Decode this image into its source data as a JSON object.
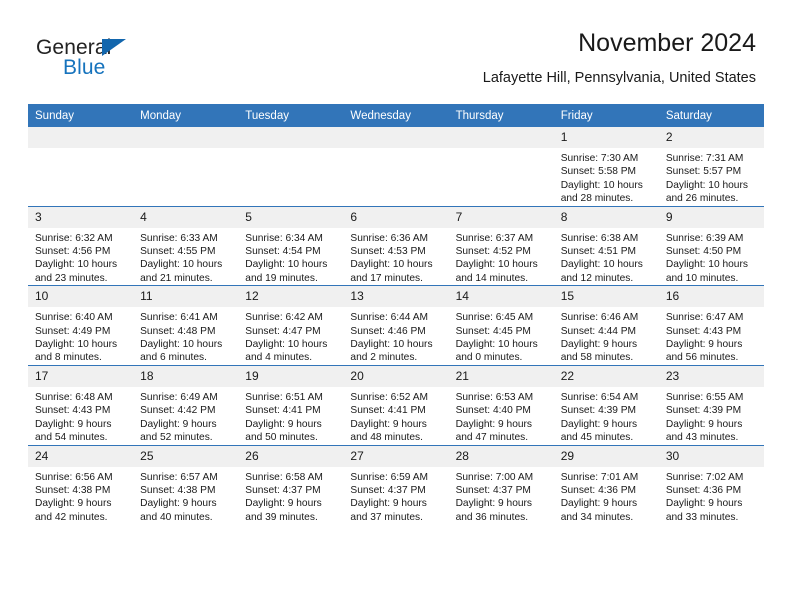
{
  "brand": {
    "name_part1": "General",
    "name_part2": "Blue",
    "flag_color": "#1266ad",
    "blue_text_color": "#1673bd"
  },
  "header": {
    "title": "November 2024",
    "subtitle": "Lafayette Hill, Pennsylvania, United States",
    "accent_color": "#3275b9",
    "daynum_band_color": "#f0f0f0"
  },
  "weekday_headers": [
    "Sunday",
    "Monday",
    "Tuesday",
    "Wednesday",
    "Thursday",
    "Friday",
    "Saturday"
  ],
  "weeks": [
    [
      {
        "day": "",
        "sunrise": "",
        "sunset": "",
        "daylight_line1": "",
        "daylight_line2": "",
        "empty": true
      },
      {
        "day": "",
        "sunrise": "",
        "sunset": "",
        "daylight_line1": "",
        "daylight_line2": "",
        "empty": true
      },
      {
        "day": "",
        "sunrise": "",
        "sunset": "",
        "daylight_line1": "",
        "daylight_line2": "",
        "empty": true
      },
      {
        "day": "",
        "sunrise": "",
        "sunset": "",
        "daylight_line1": "",
        "daylight_line2": "",
        "empty": true
      },
      {
        "day": "",
        "sunrise": "",
        "sunset": "",
        "daylight_line1": "",
        "daylight_line2": "",
        "empty": true
      },
      {
        "day": "1",
        "sunrise": "Sunrise: 7:30 AM",
        "sunset": "Sunset: 5:58 PM",
        "daylight_line1": "Daylight: 10 hours",
        "daylight_line2": "and 28 minutes.",
        "empty": false
      },
      {
        "day": "2",
        "sunrise": "Sunrise: 7:31 AM",
        "sunset": "Sunset: 5:57 PM",
        "daylight_line1": "Daylight: 10 hours",
        "daylight_line2": "and 26 minutes.",
        "empty": false
      }
    ],
    [
      {
        "day": "3",
        "sunrise": "Sunrise: 6:32 AM",
        "sunset": "Sunset: 4:56 PM",
        "daylight_line1": "Daylight: 10 hours",
        "daylight_line2": "and 23 minutes.",
        "empty": false
      },
      {
        "day": "4",
        "sunrise": "Sunrise: 6:33 AM",
        "sunset": "Sunset: 4:55 PM",
        "daylight_line1": "Daylight: 10 hours",
        "daylight_line2": "and 21 minutes.",
        "empty": false
      },
      {
        "day": "5",
        "sunrise": "Sunrise: 6:34 AM",
        "sunset": "Sunset: 4:54 PM",
        "daylight_line1": "Daylight: 10 hours",
        "daylight_line2": "and 19 minutes.",
        "empty": false
      },
      {
        "day": "6",
        "sunrise": "Sunrise: 6:36 AM",
        "sunset": "Sunset: 4:53 PM",
        "daylight_line1": "Daylight: 10 hours",
        "daylight_line2": "and 17 minutes.",
        "empty": false
      },
      {
        "day": "7",
        "sunrise": "Sunrise: 6:37 AM",
        "sunset": "Sunset: 4:52 PM",
        "daylight_line1": "Daylight: 10 hours",
        "daylight_line2": "and 14 minutes.",
        "empty": false
      },
      {
        "day": "8",
        "sunrise": "Sunrise: 6:38 AM",
        "sunset": "Sunset: 4:51 PM",
        "daylight_line1": "Daylight: 10 hours",
        "daylight_line2": "and 12 minutes.",
        "empty": false
      },
      {
        "day": "9",
        "sunrise": "Sunrise: 6:39 AM",
        "sunset": "Sunset: 4:50 PM",
        "daylight_line1": "Daylight: 10 hours",
        "daylight_line2": "and 10 minutes.",
        "empty": false
      }
    ],
    [
      {
        "day": "10",
        "sunrise": "Sunrise: 6:40 AM",
        "sunset": "Sunset: 4:49 PM",
        "daylight_line1": "Daylight: 10 hours",
        "daylight_line2": "and 8 minutes.",
        "empty": false
      },
      {
        "day": "11",
        "sunrise": "Sunrise: 6:41 AM",
        "sunset": "Sunset: 4:48 PM",
        "daylight_line1": "Daylight: 10 hours",
        "daylight_line2": "and 6 minutes.",
        "empty": false
      },
      {
        "day": "12",
        "sunrise": "Sunrise: 6:42 AM",
        "sunset": "Sunset: 4:47 PM",
        "daylight_line1": "Daylight: 10 hours",
        "daylight_line2": "and 4 minutes.",
        "empty": false
      },
      {
        "day": "13",
        "sunrise": "Sunrise: 6:44 AM",
        "sunset": "Sunset: 4:46 PM",
        "daylight_line1": "Daylight: 10 hours",
        "daylight_line2": "and 2 minutes.",
        "empty": false
      },
      {
        "day": "14",
        "sunrise": "Sunrise: 6:45 AM",
        "sunset": "Sunset: 4:45 PM",
        "daylight_line1": "Daylight: 10 hours",
        "daylight_line2": "and 0 minutes.",
        "empty": false
      },
      {
        "day": "15",
        "sunrise": "Sunrise: 6:46 AM",
        "sunset": "Sunset: 4:44 PM",
        "daylight_line1": "Daylight: 9 hours",
        "daylight_line2": "and 58 minutes.",
        "empty": false
      },
      {
        "day": "16",
        "sunrise": "Sunrise: 6:47 AM",
        "sunset": "Sunset: 4:43 PM",
        "daylight_line1": "Daylight: 9 hours",
        "daylight_line2": "and 56 minutes.",
        "empty": false
      }
    ],
    [
      {
        "day": "17",
        "sunrise": "Sunrise: 6:48 AM",
        "sunset": "Sunset: 4:43 PM",
        "daylight_line1": "Daylight: 9 hours",
        "daylight_line2": "and 54 minutes.",
        "empty": false
      },
      {
        "day": "18",
        "sunrise": "Sunrise: 6:49 AM",
        "sunset": "Sunset: 4:42 PM",
        "daylight_line1": "Daylight: 9 hours",
        "daylight_line2": "and 52 minutes.",
        "empty": false
      },
      {
        "day": "19",
        "sunrise": "Sunrise: 6:51 AM",
        "sunset": "Sunset: 4:41 PM",
        "daylight_line1": "Daylight: 9 hours",
        "daylight_line2": "and 50 minutes.",
        "empty": false
      },
      {
        "day": "20",
        "sunrise": "Sunrise: 6:52 AM",
        "sunset": "Sunset: 4:41 PM",
        "daylight_line1": "Daylight: 9 hours",
        "daylight_line2": "and 48 minutes.",
        "empty": false
      },
      {
        "day": "21",
        "sunrise": "Sunrise: 6:53 AM",
        "sunset": "Sunset: 4:40 PM",
        "daylight_line1": "Daylight: 9 hours",
        "daylight_line2": "and 47 minutes.",
        "empty": false
      },
      {
        "day": "22",
        "sunrise": "Sunrise: 6:54 AM",
        "sunset": "Sunset: 4:39 PM",
        "daylight_line1": "Daylight: 9 hours",
        "daylight_line2": "and 45 minutes.",
        "empty": false
      },
      {
        "day": "23",
        "sunrise": "Sunrise: 6:55 AM",
        "sunset": "Sunset: 4:39 PM",
        "daylight_line1": "Daylight: 9 hours",
        "daylight_line2": "and 43 minutes.",
        "empty": false
      }
    ],
    [
      {
        "day": "24",
        "sunrise": "Sunrise: 6:56 AM",
        "sunset": "Sunset: 4:38 PM",
        "daylight_line1": "Daylight: 9 hours",
        "daylight_line2": "and 42 minutes.",
        "empty": false
      },
      {
        "day": "25",
        "sunrise": "Sunrise: 6:57 AM",
        "sunset": "Sunset: 4:38 PM",
        "daylight_line1": "Daylight: 9 hours",
        "daylight_line2": "and 40 minutes.",
        "empty": false
      },
      {
        "day": "26",
        "sunrise": "Sunrise: 6:58 AM",
        "sunset": "Sunset: 4:37 PM",
        "daylight_line1": "Daylight: 9 hours",
        "daylight_line2": "and 39 minutes.",
        "empty": false
      },
      {
        "day": "27",
        "sunrise": "Sunrise: 6:59 AM",
        "sunset": "Sunset: 4:37 PM",
        "daylight_line1": "Daylight: 9 hours",
        "daylight_line2": "and 37 minutes.",
        "empty": false
      },
      {
        "day": "28",
        "sunrise": "Sunrise: 7:00 AM",
        "sunset": "Sunset: 4:37 PM",
        "daylight_line1": "Daylight: 9 hours",
        "daylight_line2": "and 36 minutes.",
        "empty": false
      },
      {
        "day": "29",
        "sunrise": "Sunrise: 7:01 AM",
        "sunset": "Sunset: 4:36 PM",
        "daylight_line1": "Daylight: 9 hours",
        "daylight_line2": "and 34 minutes.",
        "empty": false
      },
      {
        "day": "30",
        "sunrise": "Sunrise: 7:02 AM",
        "sunset": "Sunset: 4:36 PM",
        "daylight_line1": "Daylight: 9 hours",
        "daylight_line2": "and 33 minutes.",
        "empty": false
      }
    ]
  ]
}
